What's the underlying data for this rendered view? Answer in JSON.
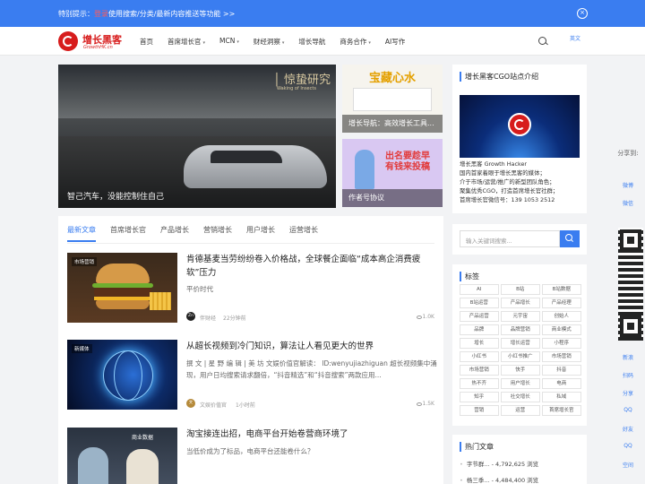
{
  "notice": {
    "prefix": "特别提示：",
    "highlight": "登录",
    "suffix": "使用搜索/分类/最新内容推送等功能 >>"
  },
  "logo": {
    "name": "增长黑客",
    "sub": "GrowthHK.cn"
  },
  "nav": [
    {
      "label": "首页",
      "caret": false
    },
    {
      "label": "首席增长官",
      "caret": true
    },
    {
      "label": "MCN",
      "caret": true
    },
    {
      "label": "财经洞察",
      "caret": true
    },
    {
      "label": "增长导航",
      "caret": false
    },
    {
      "label": "商务合作",
      "caret": true
    },
    {
      "label": "AI写作",
      "caret": false
    }
  ],
  "nav_caret": "▾",
  "lang": "英文",
  "hero": {
    "caption": "智己汽车，没能控制住自己",
    "watermark": "│ 惊蛰研究",
    "watermark_sub": "Waking of Insects"
  },
  "side_cards": [
    {
      "caption": "增长导航：高效增长工具...",
      "art_text": "宝藏心水"
    },
    {
      "caption": "作者号协议",
      "art_text": "出名要趁早 有钱来投稿"
    }
  ],
  "tabs": [
    "最新文章",
    "首席增长官",
    "产品增长",
    "营销增长",
    "用户增长",
    "运营增长"
  ],
  "posts": [
    {
      "badge": "市场营销",
      "title": "肯德基麦当劳纷纷卷入价格战，全球餐企面临“成本高企消费疲软”压力",
      "desc": "平价时代",
      "avatar": "Zn",
      "author": "伴财经",
      "time": "22分钟前",
      "views": "1.0K"
    },
    {
      "badge": "新媒体",
      "title": "从超长视频到冷门知识，算法让人看见更大的世界",
      "desc": "撰 文 | 星   野 编 辑 | 美   坊 文娱价值官解读： ID:wenyujiazhiguan 超长视频集中涌现，用户日均搜索请求翻倍，“抖音精选”和“抖音搜索”两款应用...",
      "avatar": "文",
      "author": "文娱价值官",
      "time": "1小时前",
      "views": "1.5K"
    },
    {
      "badge": "",
      "title": "淘宝接连出招，电商平台开始卷营商环境了",
      "desc": "当低价成为了标品，电商平台还能卷什么？",
      "art_text": "商业数据"
    }
  ],
  "about": {
    "title": "增长黑客CGO站点介绍",
    "lines": [
      "增长黑客 Growth Hacker",
      "国内首家着眼于增长黑客的媒体；",
      "介于市场/运营/推广的新型团队角色；",
      "聚集优秀CGO，打造首席增长官社群；",
      "首席增长官微信号：139 1053 2512"
    ]
  },
  "search": {
    "placeholder": "输入关键词搜索..."
  },
  "tags_title": "标签",
  "tags": [
    "AI",
    "B站",
    "B站数据",
    "B站运营",
    "产品增长",
    "产品经理",
    "产品运营",
    "元宇宙",
    "创始人",
    "品牌",
    "品牌营销",
    "商业模式",
    "增长",
    "增长运营",
    "小程序",
    "小红书",
    "小红书推广",
    "市场营销",
    "市场营销",
    "快手",
    "抖音",
    "热不齐",
    "用户增长",
    "电商",
    "知乎",
    "社交增长",
    "私域",
    "营销",
    "运营",
    "首席增长官"
  ],
  "hot": {
    "title": "热门文章",
    "items": [
      "字节群... - 4,792,625 浏览",
      "杨三季... - 4,484,400 浏览"
    ]
  },
  "share": {
    "title": "分享到:",
    "items": [
      "微博",
      "微信",
      "新浪",
      "扫码",
      "分享",
      "QQ",
      "好友",
      "QQ",
      "空间"
    ]
  }
}
